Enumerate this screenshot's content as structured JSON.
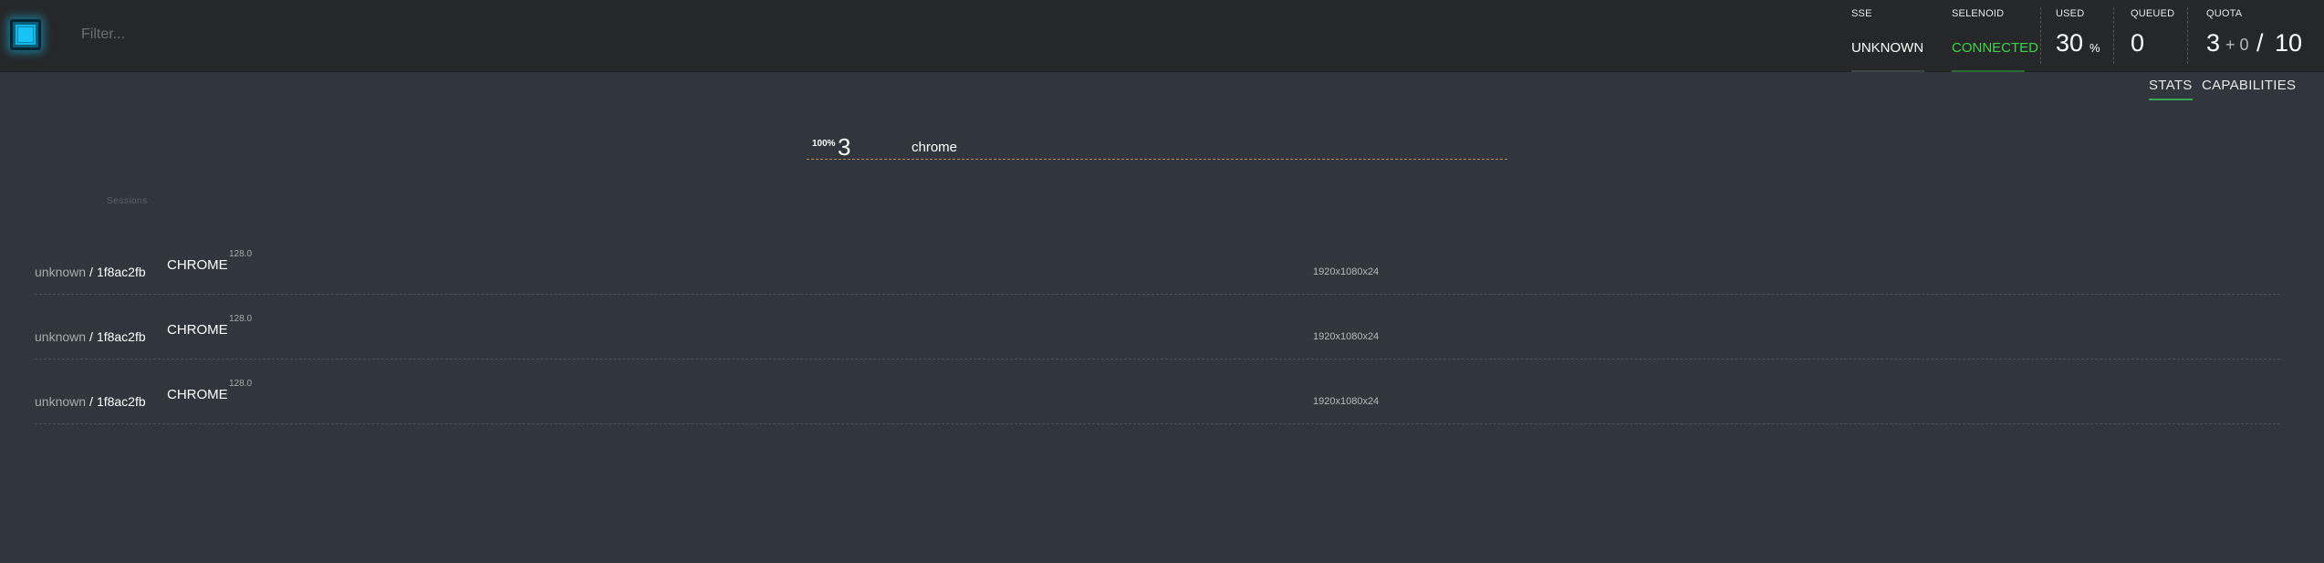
{
  "header": {
    "filter_placeholder": "Filter...",
    "sse": {
      "label": "SSE",
      "value": "UNKNOWN"
    },
    "selenoid": {
      "label": "SELENOID",
      "value": "CONNECTED"
    },
    "used": {
      "label": "USED",
      "value": "30",
      "unit": "%"
    },
    "queued": {
      "label": "QUEUED",
      "value": "0"
    },
    "quota": {
      "label": "QUOTA",
      "used": "3",
      "pending": "+ 0",
      "slash": "/",
      "total": "10"
    },
    "colors": {
      "connected": "#3fd24a",
      "logo": "#13b6e8"
    }
  },
  "tabs": [
    {
      "label": "STATS",
      "active": true
    },
    {
      "label": "CAPABILITIES",
      "active": false
    }
  ],
  "capability_stats": {
    "percent": "100%",
    "count": "3",
    "browser": "chrome"
  },
  "sessions": {
    "title": "Sessions",
    "rows": [
      {
        "quota": "unknown",
        "separator": "/",
        "id": "1f8ac2fb",
        "browser": "CHROME",
        "version": "128.0",
        "resolution": "1920x1080x24"
      },
      {
        "quota": "unknown",
        "separator": "/",
        "id": "1f8ac2fb",
        "browser": "CHROME",
        "version": "128.0",
        "resolution": "1920x1080x24"
      },
      {
        "quota": "unknown",
        "separator": "/",
        "id": "1f8ac2fb",
        "browser": "CHROME",
        "version": "128.0",
        "resolution": "1920x1080x24"
      }
    ]
  }
}
